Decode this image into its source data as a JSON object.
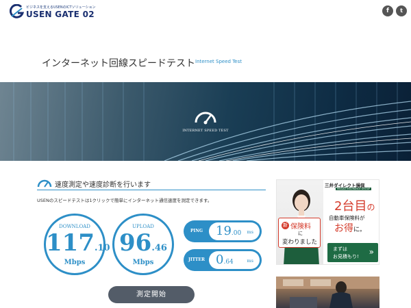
{
  "header": {
    "logo_tagline": "ビジネスを支えるUSENのICTソリューション",
    "logo_name": "USEN GATE 02",
    "social": [
      {
        "name": "facebook",
        "glyph": "f"
      },
      {
        "name": "twitter",
        "glyph": "t"
      }
    ]
  },
  "page": {
    "title": "インターネット回線スピードテスト",
    "subtitle": "Internet Speed Test"
  },
  "hero": {
    "label": "INTERNET SPEED TEST",
    "icon": "speedometer-icon"
  },
  "section": {
    "title": "速度測定や速度診断を行います",
    "description": "USENのスピードテストは1クリックで簡単にインターネット通信速度を測定できます。"
  },
  "results": {
    "download": {
      "label": "DOWNLOAD",
      "int": "117",
      "dec": ".10",
      "unit": "Mbps"
    },
    "upload": {
      "label": "UPLOAD",
      "int": "96",
      "dec": ".46",
      "unit": "Mbps"
    },
    "ping": {
      "label": "PING",
      "int": "19",
      "dec": ".00",
      "unit": "ms"
    },
    "jitter": {
      "label": "JITTER",
      "int": "0",
      "dec": ".64",
      "unit": "ms"
    }
  },
  "actions": {
    "start_label": "測定開始"
  },
  "ad": {
    "brand": "三井ダイレクト損保",
    "brand_sub": "MS&AD INSURANCE GROUP",
    "headline_big": "2台目",
    "headline_small": "の",
    "line2": "自動車保険料が",
    "line3_big": "お得",
    "line3_small": "に。",
    "card_badge": "新",
    "card_l1": "保険料",
    "card_l2": "に",
    "card_l3": "変わりました",
    "cta_l1": "まずは",
    "cta_l2": "お見積もり!",
    "cta_arrow": "»"
  },
  "colors": {
    "accent": "#2d8fc7",
    "button": "#535c68",
    "ad_red": "#d43a2a",
    "ad_green": "#1e6b44"
  }
}
